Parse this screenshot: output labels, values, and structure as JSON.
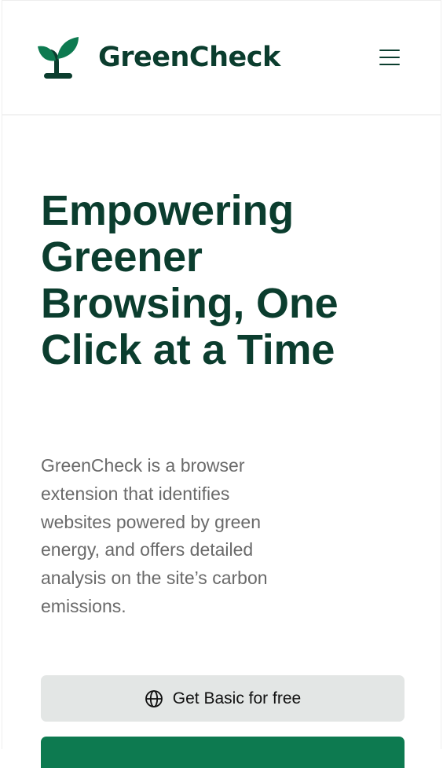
{
  "header": {
    "brand": "GreenCheck",
    "logo_icon": "sprout-icon",
    "menu_icon": "hamburger-menu-icon"
  },
  "hero": {
    "title": "Empowering Greener Browsing, One Click at a Time",
    "description": "GreenCheck is a browser extension that identifies websites powered by green energy, and offers detailed analysis on the site’s carbon emissions."
  },
  "actions": {
    "basic_label": "Get Basic for free",
    "basic_icon": "globe-icon"
  },
  "colors": {
    "brand_dark": "#0b3d2e",
    "brand_green": "#0d7a50",
    "button_gray": "#e3e6e5",
    "body_text": "#6a6a6a"
  }
}
